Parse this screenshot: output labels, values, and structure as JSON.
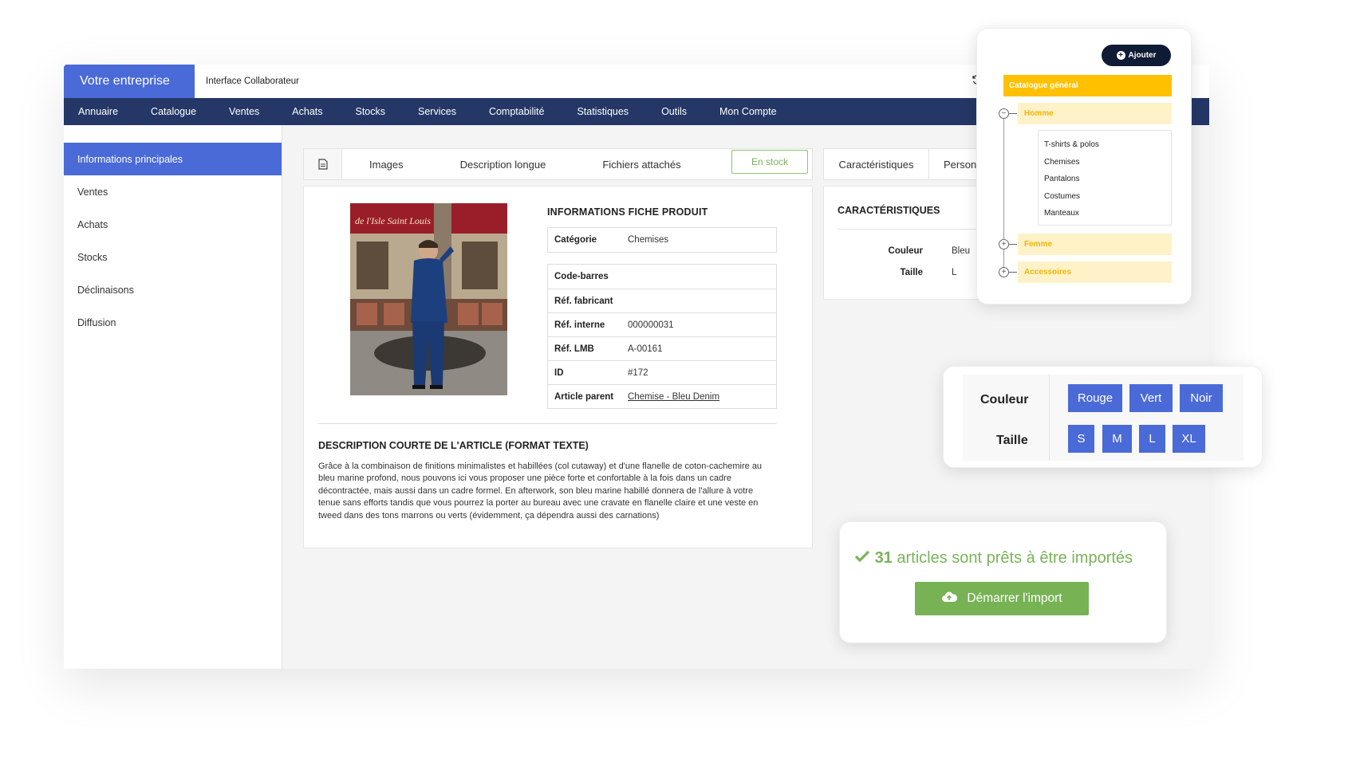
{
  "brand": "Votre entreprise",
  "subtitle": "Interface Collaborateur",
  "nav": [
    "Annuaire",
    "Catalogue",
    "Ventes",
    "Achats",
    "Stocks",
    "Services",
    "Comptabilité",
    "Statistiques",
    "Outils",
    "Mon Compte"
  ],
  "sidebar": [
    "Informations principales",
    "Ventes",
    "Achats",
    "Stocks",
    "Déclinaisons",
    "Diffusion"
  ],
  "tabs": {
    "images": "Images",
    "description_longue": "Description longue",
    "fichiers": "Fichiers attachés",
    "stock_badge": "En stock",
    "caracteristiques": "Caractéristiques",
    "personnalisations": "Personnalisations"
  },
  "product": {
    "info_title": "INFORMATIONS FICHE PRODUIT",
    "category_label": "Catégorie",
    "category_value": "Chemises",
    "rows": [
      {
        "label": "Code-barres",
        "value": ""
      },
      {
        "label": "Réf. fabricant",
        "value": ""
      },
      {
        "label": "Réf. interne",
        "value": "000000031"
      },
      {
        "label": "Réf. LMB",
        "value": "A-00161"
      },
      {
        "label": "ID",
        "value": "#172"
      },
      {
        "label": "Article parent",
        "value": "Chemise - Bleu Denim"
      }
    ],
    "photo_sign": "de l'Isle Saint Louis",
    "desc_title": "DESCRIPTION COURTE DE L'ARTICLE (FORMAT TEXTE)",
    "desc_text": "Grâce à la combinaison de finitions minimalistes et habillées (col cutaway) et d'une flanelle de coton-cachemire au bleu marine profond, nous pouvons ici vous proposer une pièce forte et confortable à la fois dans un cadre décontractée, mais aussi dans un cadre formel. En afterwork, son bleu marine habillé donnera de l'allure à votre tenue sans efforts tandis que vous pourrez la porter au bureau avec une cravate en flanelle claire et une veste en tweed dans des tons marrons ou verts (évidemment, ça dépendra aussi des carnations)"
  },
  "carac": {
    "title": "CARACTÉRISTIQUES",
    "rows": [
      {
        "label": "Couleur",
        "value": "Bleu"
      },
      {
        "label": "Taille",
        "value": "L"
      }
    ]
  },
  "category_tree": {
    "add_button": "Ajouter",
    "root": "Catalogue général",
    "homme": "Homme",
    "homme_children": [
      "T-shirts & polos",
      "Chemises",
      "Pantalons",
      "Costumes",
      "Manteaux"
    ],
    "femme": "Femme",
    "accessoires": "Accessoires",
    "colors": {
      "root": "#ffc000",
      "item_bg": "#fff2c9",
      "item_text": "#f2b400"
    }
  },
  "variants": {
    "couleur_label": "Couleur",
    "taille_label": "Taille",
    "couleurs": [
      "Rouge",
      "Vert",
      "Noir"
    ],
    "tailles": [
      "S",
      "M",
      "L",
      "XL"
    ],
    "chip_color": "#4a6ad8"
  },
  "import": {
    "count": "31",
    "message": "articles sont prêts à être importés",
    "button": "Démarrer l'import",
    "color": "#77b255"
  },
  "colors": {
    "accent": "#4a6ad8",
    "nav_bg": "#243766",
    "success": "#7ab35a"
  }
}
